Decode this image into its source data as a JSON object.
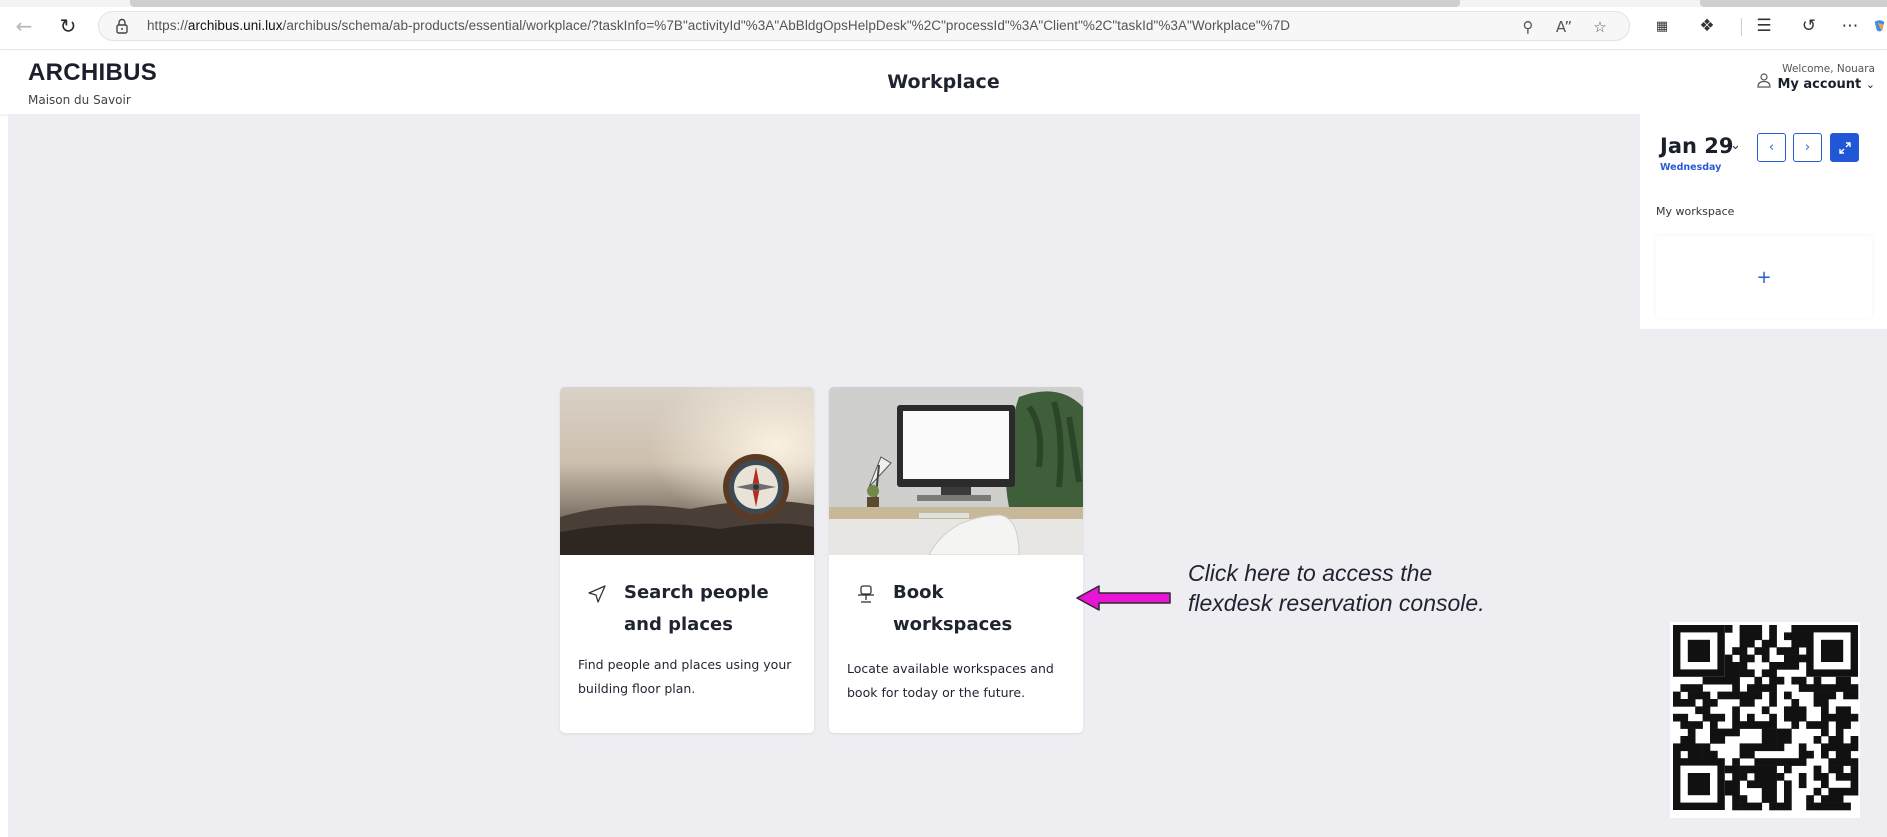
{
  "browser": {
    "url_prefix": "https://",
    "url_domain": "archibus.uni.lux",
    "url_path": "/archibus/schema/ab-products/essential/workplace/?taskInfo=%7B\"activityId\"%3A\"AbBldgOpsHelpDesk\"%2C\"processId\"%3A\"Client\"%2C\"taskId\"%3A\"Workplace\"%7D"
  },
  "header": {
    "brand": "ARCHIBUS",
    "brand_subtitle": "Maison du Savoir",
    "title": "Workplace",
    "welcome": "Welcome, Nouara",
    "account_label": "My account"
  },
  "cards": [
    {
      "title": "Search people and places",
      "description": "Find people and places using your building floor plan."
    },
    {
      "title": "Book workspaces",
      "description": "Locate available workspaces and book for today or the future."
    }
  ],
  "annotation": {
    "line1": "Click here to access the",
    "line2": "flexdesk reservation console.",
    "arrow_color": "#e815d6"
  },
  "side_panel": {
    "date": "Jan 29",
    "weekday": "Wednesday",
    "workspace_label": "My workspace",
    "add_symbol": "+"
  },
  "colors": {
    "accent": "#2a5bd7",
    "background": "#ededf2"
  }
}
